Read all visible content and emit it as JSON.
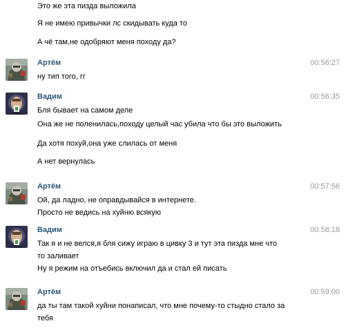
{
  "messages": [
    {
      "author": "",
      "time": "",
      "avatar": "",
      "lines": [
        "Это же эта пизда выложила"
      ]
    },
    {
      "author": "",
      "time": "",
      "avatar": "",
      "lines": [
        "Я не имею привычки лс скидывать куда то"
      ]
    },
    {
      "author": "",
      "time": "",
      "avatar": "",
      "lines": [
        "А чё там,не одобряют меня походу да?"
      ]
    },
    {
      "author": "Артём",
      "time": "00:56:27",
      "avatar": "artem-avatar",
      "lines": [
        "ну тип того, гг"
      ]
    },
    {
      "author": "Вадим",
      "time": "00:56:35",
      "avatar": "vadim-avatar",
      "lines": [
        "Бля бывает на самом деле"
      ]
    },
    {
      "author": "",
      "time": "",
      "avatar": "",
      "lines": [
        "Она же не поленилась,походу целый час убила что бы это выложить"
      ]
    },
    {
      "author": "",
      "time": "",
      "avatar": "",
      "lines": [
        "Да хотя похуй,она уже слилась от меня"
      ]
    },
    {
      "author": "",
      "time": "",
      "avatar": "",
      "lines": [
        "А нет вернулась"
      ]
    },
    {
      "author": "Артём",
      "time": "00:57:56",
      "avatar": "artem-avatar",
      "lines": [
        "Ой, да ладно, не оправдывайся в интернете.",
        "Просто не ведись на хуйню всякую"
      ]
    },
    {
      "author": "Вадим",
      "time": "00:58:18",
      "avatar": "vadim-avatar",
      "lines": [
        "Так я и не велся,я бля сижу играю в цивку 3 и тут эта пизда мне что",
        "то заливает"
      ]
    },
    {
      "author": "",
      "time": "",
      "avatar": "",
      "lines": [
        "Ну я режим на отъебись включил да и стал ей писать"
      ]
    },
    {
      "author": "Артём",
      "time": "00:59:00",
      "avatar": "artem-avatar",
      "lines": [
        "да ты там такой хуйни понаписал, что мне почему-то стыдно стало за",
        "тебя"
      ]
    }
  ],
  "colors": {
    "author": "#2b587a",
    "time": "#999999",
    "text": "#000000",
    "background": "#ffffff"
  }
}
